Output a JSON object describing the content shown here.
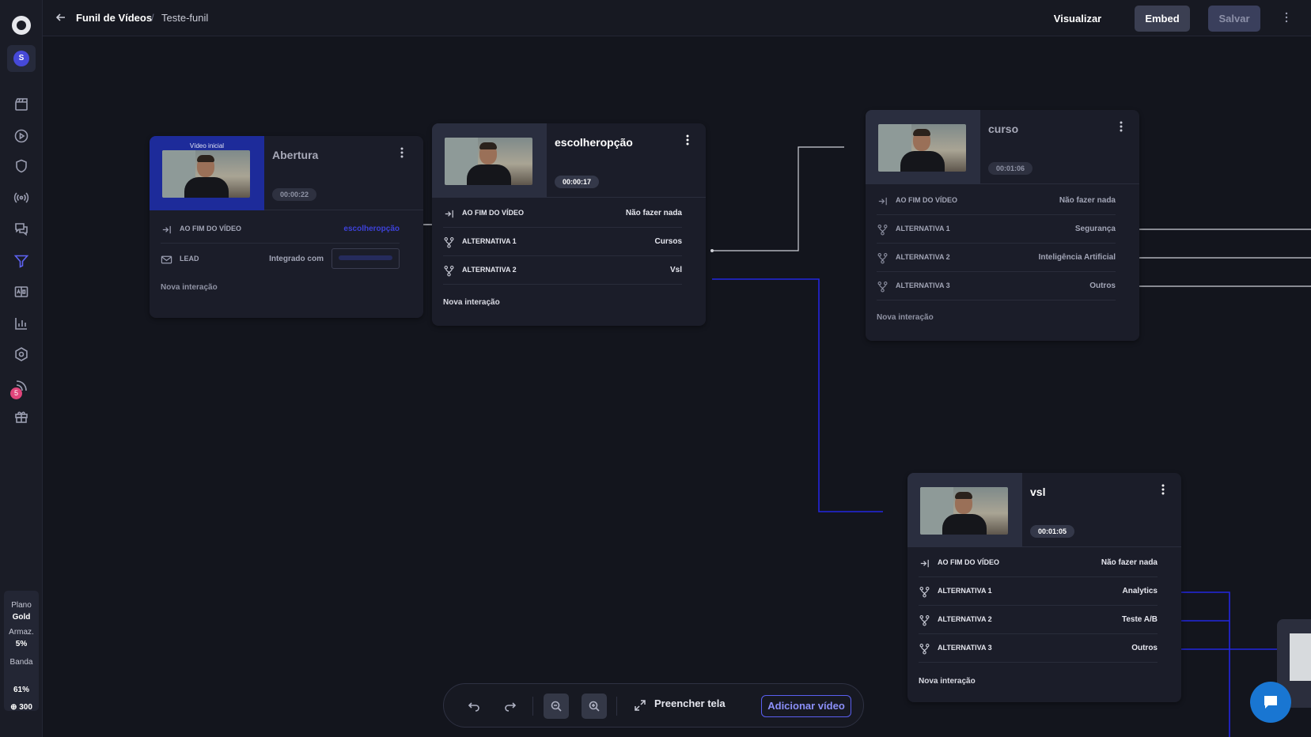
{
  "header": {
    "back_icon": "arrow-left-icon",
    "breadcrumb_root": "Funil de Vídeos",
    "breadcrumb_sep": "/",
    "breadcrumb_current": "Teste-funil",
    "visualizar": "Visualizar",
    "embed": "Embed",
    "salvar": "Salvar"
  },
  "sidebar": {
    "avatar_initial": "S",
    "badge_count": "5",
    "icons": [
      "clapperboard-icon",
      "play-circle-icon",
      "shield-icon",
      "broadcast-icon",
      "chat-icon",
      "funnel-icon",
      "ab-test-icon",
      "bar-chart-icon",
      "settings-icon",
      "rss-icon",
      "gift-icon"
    ],
    "plan": {
      "plano_label": "Plano",
      "plano_value": "Gold",
      "armaz_label": "Armaz.",
      "armaz_value": "5%",
      "banda_label": "Banda",
      "banda_value": "61%",
      "credits": "300"
    }
  },
  "nodes": {
    "abertura": {
      "badge": "Vídeo inicial",
      "title": "Abertura",
      "duration": "00:00:22",
      "row_end_label": "AO FIM DO VÍDEO",
      "row_end_value": "escolheropção",
      "row_lead_label": "LEAD",
      "row_lead_value": "Integrado com",
      "new_interaction": "Nova interação"
    },
    "escolheropcao": {
      "title": "escolheropção",
      "duration": "00:00:17",
      "rows": [
        {
          "label": "AO FIM DO VÍDEO",
          "value": "Não fazer nada"
        },
        {
          "label": "ALTERNATIVA 1",
          "value": "Cursos"
        },
        {
          "label": "ALTERNATIVA 2",
          "value": "Vsl"
        }
      ],
      "new_interaction": "Nova interação"
    },
    "curso": {
      "title": "curso",
      "duration": "00:01:06",
      "rows": [
        {
          "label": "AO FIM DO VÍDEO",
          "value": "Não fazer nada"
        },
        {
          "label": "ALTERNATIVA 1",
          "value": "Segurança"
        },
        {
          "label": "ALTERNATIVA 2",
          "value": "Inteligência Artificial"
        },
        {
          "label": "ALTERNATIVA 3",
          "value": "Outros"
        }
      ],
      "new_interaction": "Nova interação"
    },
    "vsl": {
      "title": "vsl",
      "duration": "00:01:05",
      "rows": [
        {
          "label": "AO FIM DO VÍDEO",
          "value": "Não fazer nada"
        },
        {
          "label": "ALTERNATIVA 1",
          "value": "Analytics"
        },
        {
          "label": "ALTERNATIVA 2",
          "value": "Teste A/B"
        },
        {
          "label": "ALTERNATIVA 3",
          "value": "Outros"
        }
      ],
      "new_interaction": "Nova interação"
    }
  },
  "toolbar": {
    "fill_screen": "Preencher tela",
    "add_video": "Adicionar vídeo"
  },
  "colors": {
    "accent": "#5e63f2",
    "link_blue": "#1d1fd1",
    "wire_gray": "#cfd1d8",
    "background": "#13151d"
  }
}
